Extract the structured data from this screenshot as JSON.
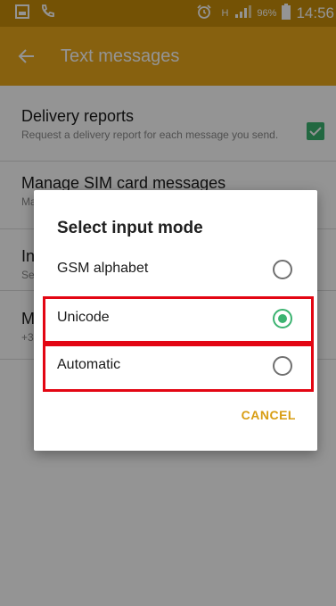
{
  "status_bar": {
    "battery_percent": "96%",
    "time": "14:56",
    "network_type": "H"
  },
  "app_bar": {
    "title": "Text messages"
  },
  "settings": {
    "delivery_reports": {
      "title": "Delivery reports",
      "subtitle": "Request a delivery report for each message you send.",
      "checked": true
    },
    "manage_sim": {
      "title": "Manage SIM card messages",
      "subtitle": "Ma"
    },
    "input_mode": {
      "title": "In",
      "subtitle": "Se"
    },
    "message_center": {
      "title": "M",
      "subtitle": "+3"
    }
  },
  "dialog": {
    "title": "Select input mode",
    "options": [
      {
        "label": "GSM alphabet",
        "selected": false
      },
      {
        "label": "Unicode",
        "selected": true
      },
      {
        "label": "Automatic",
        "selected": false
      }
    ],
    "cancel_label": "CANCEL"
  },
  "colors": {
    "status_bar": "#c98e0a",
    "app_bar": "#e8a71a",
    "accent_green": "#3cb371",
    "highlight_red": "#e30613",
    "cancel_text": "#d89d12"
  },
  "icons": {
    "back": "arrow-left-icon",
    "checkbox": "check-icon",
    "alarm": "alarm-icon",
    "signal": "signal-icon",
    "battery": "battery-icon"
  }
}
